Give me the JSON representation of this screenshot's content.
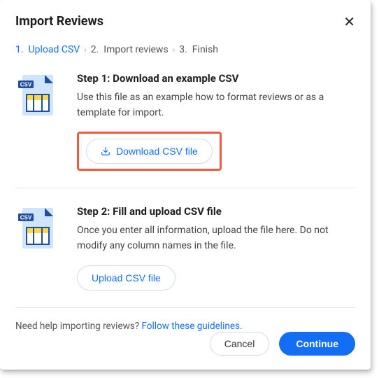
{
  "header": {
    "title": "Import Reviews"
  },
  "steps_bar": {
    "items": [
      {
        "num": "1.",
        "label": "Upload CSV"
      },
      {
        "num": "2.",
        "label": "Import reviews"
      },
      {
        "num": "3.",
        "label": "Finish"
      }
    ]
  },
  "section1": {
    "heading": "Step 1: Download an example CSV",
    "desc": "Use this file as an example how to format reviews or as a template for import.",
    "button": "Download CSV file"
  },
  "section2": {
    "heading": "Step 2: Fill and upload CSV file",
    "desc": "Once you enter all information, upload the file here. Do not modify any column names in the file.",
    "button": "Upload CSV file"
  },
  "help": {
    "text": "Need help importing reviews? ",
    "link": "Follow these guidelines."
  },
  "footer": {
    "cancel": "Cancel",
    "continue": "Continue"
  }
}
